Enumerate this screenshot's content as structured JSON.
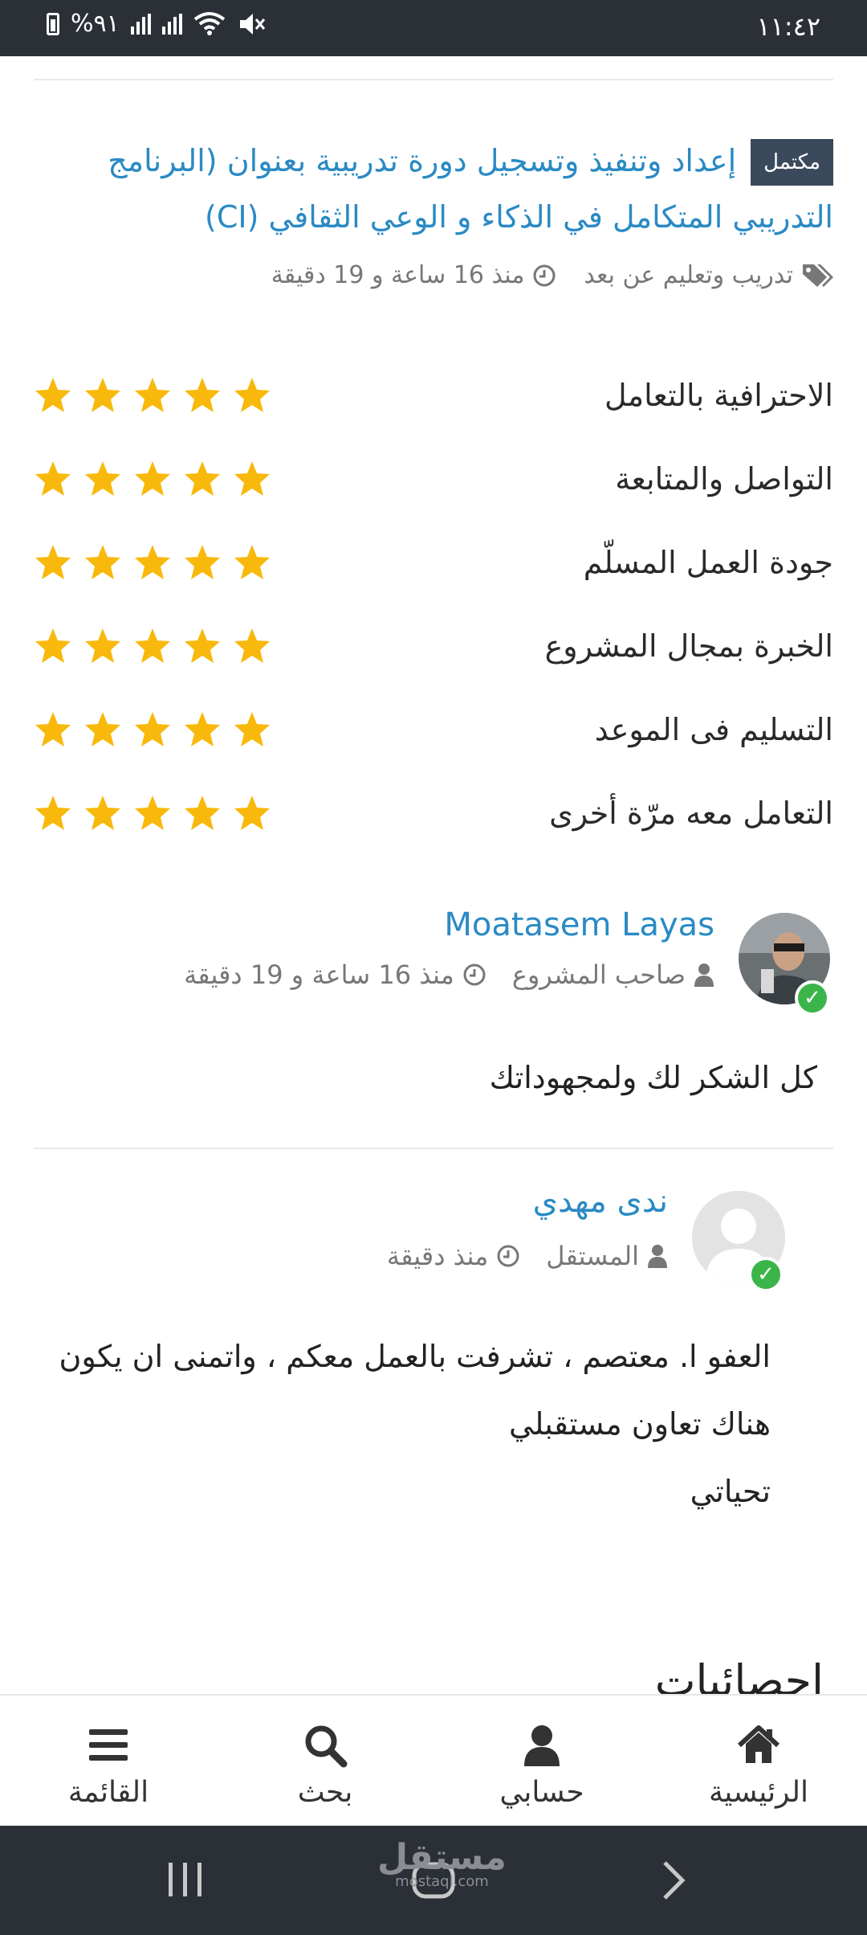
{
  "status_bar": {
    "time": "١١:٤٢",
    "battery": "%٩١"
  },
  "project": {
    "badge": "مكتمل",
    "title": "إعداد وتنفيذ وتسجيل دورة تدريبية بعنوان (البرنامج التدريبي المتكامل في الذكاء و الوعي الثقافي (CI)",
    "category": "تدريب وتعليم عن بعد",
    "time_ago": "منذ 16 ساعة و 19 دقيقة"
  },
  "ratings": [
    {
      "label": "الاحترافية بالتعامل",
      "stars": 5
    },
    {
      "label": "التواصل والمتابعة",
      "stars": 5
    },
    {
      "label": "جودة العمل المسلّم",
      "stars": 5
    },
    {
      "label": "الخبرة بمجال المشروع",
      "stars": 5
    },
    {
      "label": "التسليم فى الموعد",
      "stars": 5
    },
    {
      "label": "التعامل معه مرّة أخرى",
      "stars": 5
    }
  ],
  "comments": [
    {
      "author": "Moatasem Layas",
      "role": "صاحب المشروع",
      "time_ago": "منذ 16 ساعة و 19 دقيقة",
      "lines": [
        "كل الشكر لك ولمجهوداتك"
      ]
    },
    {
      "author": "ندى مهدي",
      "role": "المستقل",
      "time_ago": "منذ دقيقة",
      "lines": [
        "العفو ا. معتصم ، تشرفت بالعمل معكم ، واتمنى ان يكون",
        "هناك تعاون مستقبلي",
        "تحياتي"
      ]
    }
  ],
  "stats_heading": "احصائيات",
  "bottom_nav": [
    {
      "label": "الرئيسية",
      "icon": "home-icon"
    },
    {
      "label": "حسابي",
      "icon": "user-icon"
    },
    {
      "label": "بحث",
      "icon": "search-icon"
    },
    {
      "label": "القائمة",
      "icon": "menu-icon"
    }
  ],
  "watermark": {
    "main": "مستقل",
    "sub": "mostaql.com"
  },
  "colors": {
    "accent": "#2a8ac4",
    "star": "#f8b90c",
    "badge": "#3a4a5c",
    "verified": "#3bb54a"
  }
}
